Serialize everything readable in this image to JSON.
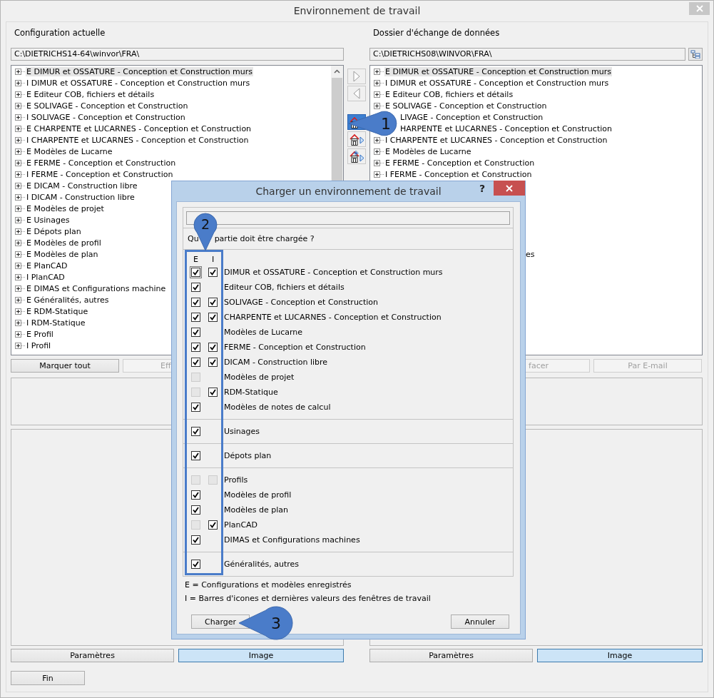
{
  "window": {
    "title": "Environnement de travail"
  },
  "current": {
    "label": "Configuration actuelle",
    "path": "C:\\DIETRICHS14-64\\winvor\\FRA\\",
    "tree": [
      {
        "text": "E DIMUR et OSSATURE - Conception et Construction murs",
        "selected": true
      },
      {
        "text": "I DIMUR et OSSATURE - Conception et Construction murs",
        "selected": false
      },
      {
        "text": "E Editeur COB, fichiers et détails",
        "selected": false
      },
      {
        "text": "E SOLIVAGE - Conception et Construction",
        "selected": false
      },
      {
        "text": "I SOLIVAGE - Conception et Construction",
        "selected": false
      },
      {
        "text": "E CHARPENTE et LUCARNES - Conception et Construction",
        "selected": false
      },
      {
        "text": "I CHARPENTE et LUCARNES - Conception et Construction",
        "selected": false
      },
      {
        "text": "E Modèles de Lucarne",
        "selected": false
      },
      {
        "text": "E FERME - Conception et Construction",
        "selected": false
      },
      {
        "text": "I FERME - Conception et Construction",
        "selected": false
      },
      {
        "text": "E DICAM - Construction libre",
        "selected": false
      },
      {
        "text": "I DICAM - Construction libre",
        "selected": false
      },
      {
        "text": "E Modèles de projet",
        "selected": false
      },
      {
        "text": "E Usinages",
        "selected": false
      },
      {
        "text": "E Dépots plan",
        "selected": false
      },
      {
        "text": "E Modèles de profil",
        "selected": false
      },
      {
        "text": "E Modèles de plan",
        "selected": false
      },
      {
        "text": "E PlanCAD",
        "selected": false
      },
      {
        "text": "I PlanCAD",
        "selected": false
      },
      {
        "text": "E DIMAS et Configurations machine",
        "selected": false
      },
      {
        "text": "E Généralités, autres",
        "selected": false
      },
      {
        "text": "E RDM-Statique",
        "selected": false
      },
      {
        "text": "I RDM-Statique",
        "selected": false
      },
      {
        "text": "E Profil",
        "selected": false
      },
      {
        "text": "I Profil",
        "selected": false
      }
    ],
    "actions": [
      {
        "label": "Marquer tout",
        "disabled": false,
        "kind": "full"
      },
      {
        "label": "Eff",
        "disabled": true,
        "kind": "cut_right"
      }
    ],
    "views": [
      {
        "label": "Paramètres",
        "selected": false
      },
      {
        "label": "Image",
        "selected": true
      }
    ]
  },
  "transfer": [
    {
      "kind": "arrow_right",
      "selected": false
    },
    {
      "kind": "arrow_left",
      "selected": false
    },
    {
      "kind": "house_left",
      "selected": true
    },
    {
      "kind": "house_right",
      "selected": false
    },
    {
      "kind": "house_new",
      "selected": false
    }
  ],
  "exchange": {
    "label": "Dossier d'échange de données",
    "path": "C:\\DIETRICHS08\\WINVOR\\FRA\\",
    "tree": [
      {
        "text": "E DIMUR et OSSATURE - Conception et Construction murs",
        "selected": true,
        "kind": "node"
      },
      {
        "text": "I DIMUR et OSSATURE - Conception et Construction murs",
        "selected": false,
        "kind": "node"
      },
      {
        "text": "E Editeur COB, fichiers et détails",
        "selected": false,
        "kind": "node"
      },
      {
        "text": "E SOLIVAGE - Conception et Construction",
        "selected": false,
        "kind": "node"
      },
      {
        "text": "LIVAGE - Conception et Construction",
        "selected": false,
        "kind": "fragment"
      },
      {
        "text": "HARPENTE et LUCARNES - Conception et Construction",
        "selected": false,
        "kind": "fragment"
      },
      {
        "text": "I CHARPENTE et LUCARNES - Conception et Construction",
        "selected": false,
        "kind": "node"
      },
      {
        "text": "E Modèles de Lucarne",
        "selected": false,
        "kind": "node"
      },
      {
        "text": "E FERME - Conception et Construction",
        "selected": false,
        "kind": "node"
      },
      {
        "text": "I FERME - Conception et Construction",
        "selected": false,
        "kind": "node"
      }
    ],
    "tree_tail": "es",
    "actions": [
      {
        "label": "facer",
        "disabled": true,
        "kind": "cut_left"
      },
      {
        "label": "Par E-mail",
        "disabled": true,
        "kind": "full"
      }
    ],
    "views": [
      {
        "label": "Paramètres",
        "selected": false
      },
      {
        "label": "Image",
        "selected": true
      }
    ]
  },
  "finish": "Fin",
  "dialog": {
    "title": "Charger un environnement de travail",
    "help": "?",
    "question_start": "Qu",
    "question_end": "partie doit être chargée ?",
    "column_e": "E",
    "column_i": "I",
    "groups": [
      {
        "rows": [
          {
            "label": "DIMUR et OSSATURE - Conception et Construction murs",
            "e": {
              "checked": true,
              "disabled": false,
              "focused": true
            },
            "i": {
              "checked": true,
              "disabled": false,
              "focused": false
            }
          },
          {
            "label": "Editeur COB, fichiers et détails",
            "e": {
              "checked": true,
              "disabled": false,
              "focused": false
            }
          },
          {
            "label": "SOLIVAGE - Conception et Construction",
            "e": {
              "checked": true,
              "disabled": false,
              "focused": false
            },
            "i": {
              "checked": true,
              "disabled": false,
              "focused": false
            }
          },
          {
            "label": "CHARPENTE et LUCARNES - Conception et Construction",
            "e": {
              "checked": true,
              "disabled": false,
              "focused": false
            },
            "i": {
              "checked": true,
              "disabled": false,
              "focused": false
            }
          },
          {
            "label": "Modèles de Lucarne",
            "e": {
              "checked": true,
              "disabled": false,
              "focused": false
            }
          },
          {
            "label": "FERME - Conception et Construction",
            "e": {
              "checked": true,
              "disabled": false,
              "focused": false
            },
            "i": {
              "checked": true,
              "disabled": false,
              "focused": false
            }
          },
          {
            "label": "DICAM - Construction libre",
            "e": {
              "checked": true,
              "disabled": false,
              "focused": false
            },
            "i": {
              "checked": true,
              "disabled": false,
              "focused": false
            }
          },
          {
            "label": "Modèles de projet",
            "e": {
              "checked": false,
              "disabled": true,
              "focused": false
            }
          },
          {
            "label": "RDM-Statique",
            "e": {
              "checked": false,
              "disabled": true,
              "focused": false
            },
            "i": {
              "checked": true,
              "disabled": false,
              "focused": false
            }
          },
          {
            "label": "Modèles de notes de calcul",
            "e": {
              "checked": true,
              "disabled": false,
              "focused": false
            }
          }
        ]
      },
      {
        "rows": [
          {
            "label": "Usinages",
            "e": {
              "checked": true,
              "disabled": false,
              "focused": false
            }
          }
        ]
      },
      {
        "rows": [
          {
            "label": "Dépots plan",
            "e": {
              "checked": true,
              "disabled": false,
              "focused": false
            }
          }
        ]
      },
      {
        "rows": [
          {
            "label": "Profils",
            "e": {
              "checked": false,
              "disabled": true,
              "focused": false
            },
            "i": {
              "checked": false,
              "disabled": true,
              "focused": false
            }
          },
          {
            "label": "Modèles de profil",
            "e": {
              "checked": true,
              "disabled": false,
              "focused": false
            }
          },
          {
            "label": "Modèles de plan",
            "e": {
              "checked": true,
              "disabled": false,
              "focused": false
            }
          },
          {
            "label": "PlanCAD",
            "e": {
              "checked": false,
              "disabled": true,
              "focused": false
            },
            "i": {
              "checked": true,
              "disabled": false,
              "focused": false
            }
          },
          {
            "label": "DIMAS et Configurations machines",
            "e": {
              "checked": true,
              "disabled": false,
              "focused": false
            }
          }
        ]
      },
      {
        "rows": [
          {
            "label": "Généralités, autres",
            "e": {
              "checked": true,
              "disabled": false,
              "focused": false
            }
          }
        ]
      }
    ],
    "legend": [
      "E = Configurations et modèles enregistrés",
      "I = Barres d'icones et dernières valeurs des fenêtres de travail"
    ],
    "buttons": [
      {
        "label": "Charger"
      },
      {
        "label": "Annuler"
      }
    ]
  },
  "callouts": [
    {
      "number": "1",
      "kind": "pointer_left"
    },
    {
      "number": "2",
      "kind": "pointer_down"
    },
    {
      "number": "3",
      "kind": "pointer_left"
    }
  ]
}
